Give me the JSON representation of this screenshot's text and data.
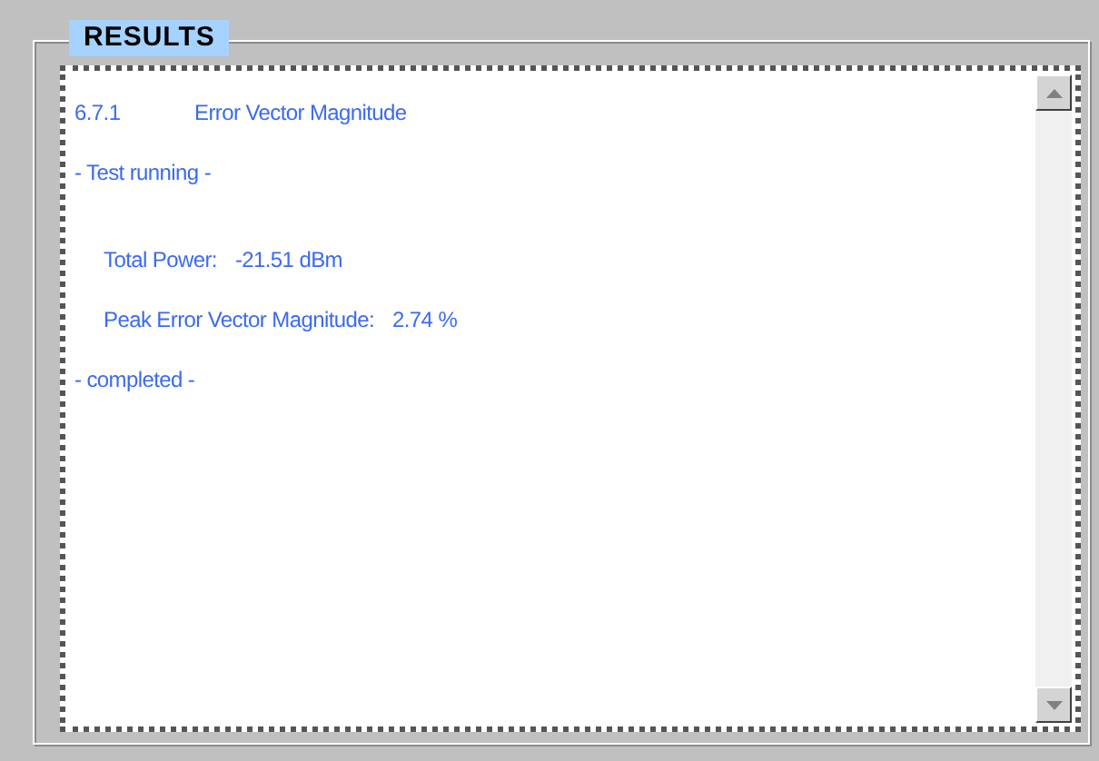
{
  "group": {
    "title": "RESULTS"
  },
  "lines": [
    {
      "kind": "heading",
      "number": "6.7.1",
      "title": "Error Vector Magnitude"
    },
    {
      "kind": "status",
      "text": "- Test running -"
    },
    {
      "kind": "measurement",
      "label": "Total Power:",
      "value": "-21.51 dBm"
    },
    {
      "kind": "measurement",
      "label": "Peak Error Vector Magnitude:",
      "value": "2.74 %"
    },
    {
      "kind": "status",
      "text": "- completed -"
    }
  ]
}
